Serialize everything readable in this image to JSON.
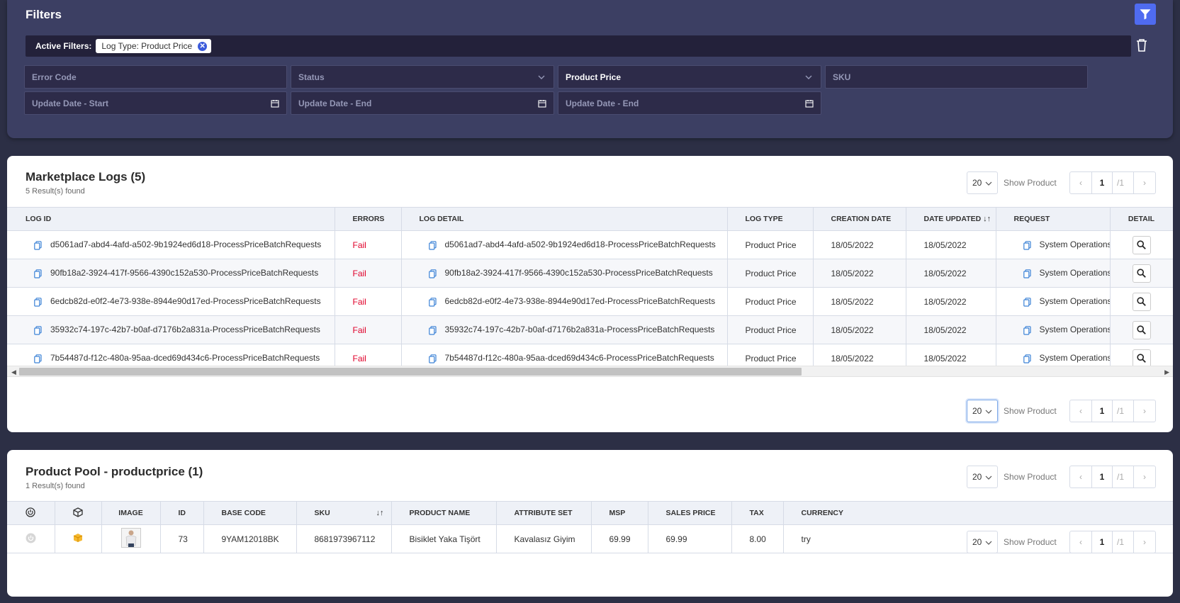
{
  "filters": {
    "title": "Filters",
    "active_label": "Active Filters:",
    "chip_label": "Log Type: Product Price",
    "fields": {
      "error_code": "Error Code",
      "status": "Status",
      "log_type": "Product Price",
      "sku": "SKU",
      "date_start": "Update Date - Start",
      "date_end": "Update Date - End",
      "date_end2": "Update Date - End"
    }
  },
  "logs": {
    "title": "Marketplace Logs (5)",
    "subtitle": "5 Result(s) found",
    "page_size": "20",
    "show_label": "Show Product",
    "page": "1",
    "page_total": "/1",
    "columns": [
      "LOG ID",
      "ERRORS",
      "LOG DETAIL",
      "LOG TYPE",
      "CREATION DATE",
      "DATE UPDATED",
      "REQUEST",
      "DETAIL"
    ],
    "rows": [
      {
        "id": "d5061ad7-abd4-4afd-a502-9b1924ed6d18-ProcessPriceBatchRequests",
        "error": "Fail",
        "detail": "d5061ad7-abd4-4afd-a502-9b1924ed6d18-ProcessPriceBatchRequests",
        "type": "Product Price",
        "created": "18/05/2022",
        "updated": "18/05/2022",
        "request": "System Operations"
      },
      {
        "id": "90fb18a2-3924-417f-9566-4390c152a530-ProcessPriceBatchRequests",
        "error": "Fail",
        "detail": "90fb18a2-3924-417f-9566-4390c152a530-ProcessPriceBatchRequests",
        "type": "Product Price",
        "created": "18/05/2022",
        "updated": "18/05/2022",
        "request": "System Operations"
      },
      {
        "id": "6edcb82d-e0f2-4e73-938e-8944e90d17ed-ProcessPriceBatchRequests",
        "error": "Fail",
        "detail": "6edcb82d-e0f2-4e73-938e-8944e90d17ed-ProcessPriceBatchRequests",
        "type": "Product Price",
        "created": "18/05/2022",
        "updated": "18/05/2022",
        "request": "System Operations"
      },
      {
        "id": "35932c74-197c-42b7-b0af-d7176b2a831a-ProcessPriceBatchRequests",
        "error": "Fail",
        "detail": "35932c74-197c-42b7-b0af-d7176b2a831a-ProcessPriceBatchRequests",
        "type": "Product Price",
        "created": "18/05/2022",
        "updated": "18/05/2022",
        "request": "System Operations"
      },
      {
        "id": "7b54487d-f12c-480a-95aa-dced69d434c6-ProcessPriceBatchRequests",
        "error": "Fail",
        "detail": "7b54487d-f12c-480a-95aa-dced69d434c6-ProcessPriceBatchRequests",
        "type": "Product Price",
        "created": "18/05/2022",
        "updated": "18/05/2022",
        "request": "System Operations"
      }
    ]
  },
  "pool": {
    "title": "Product Pool - productprice (1)",
    "subtitle": "1 Result(s) found",
    "page_size": "20",
    "show_label": "Show Product",
    "page": "1",
    "page_total": "/1",
    "columns": [
      "IMAGE",
      "ID",
      "BASE CODE",
      "SKU",
      "PRODUCT NAME",
      "ATTRIBUTE SET",
      "MSP",
      "SALES PRICE",
      "TAX",
      "CURRENCY"
    ],
    "rows": [
      {
        "id": "73",
        "base_code": "9YAM12018BK",
        "sku": "8681973967112",
        "name": "Bisiklet Yaka Tişört",
        "attribute_set": "Kavalasız Giyim",
        "msp": "69.99",
        "sales_price": "69.99",
        "tax": "8.00",
        "currency": "try"
      }
    ]
  },
  "colors": {
    "accent": "#4f6bf0",
    "fail": "#e0002a",
    "panel": "#3c3f63",
    "background": "#2c2f45"
  }
}
